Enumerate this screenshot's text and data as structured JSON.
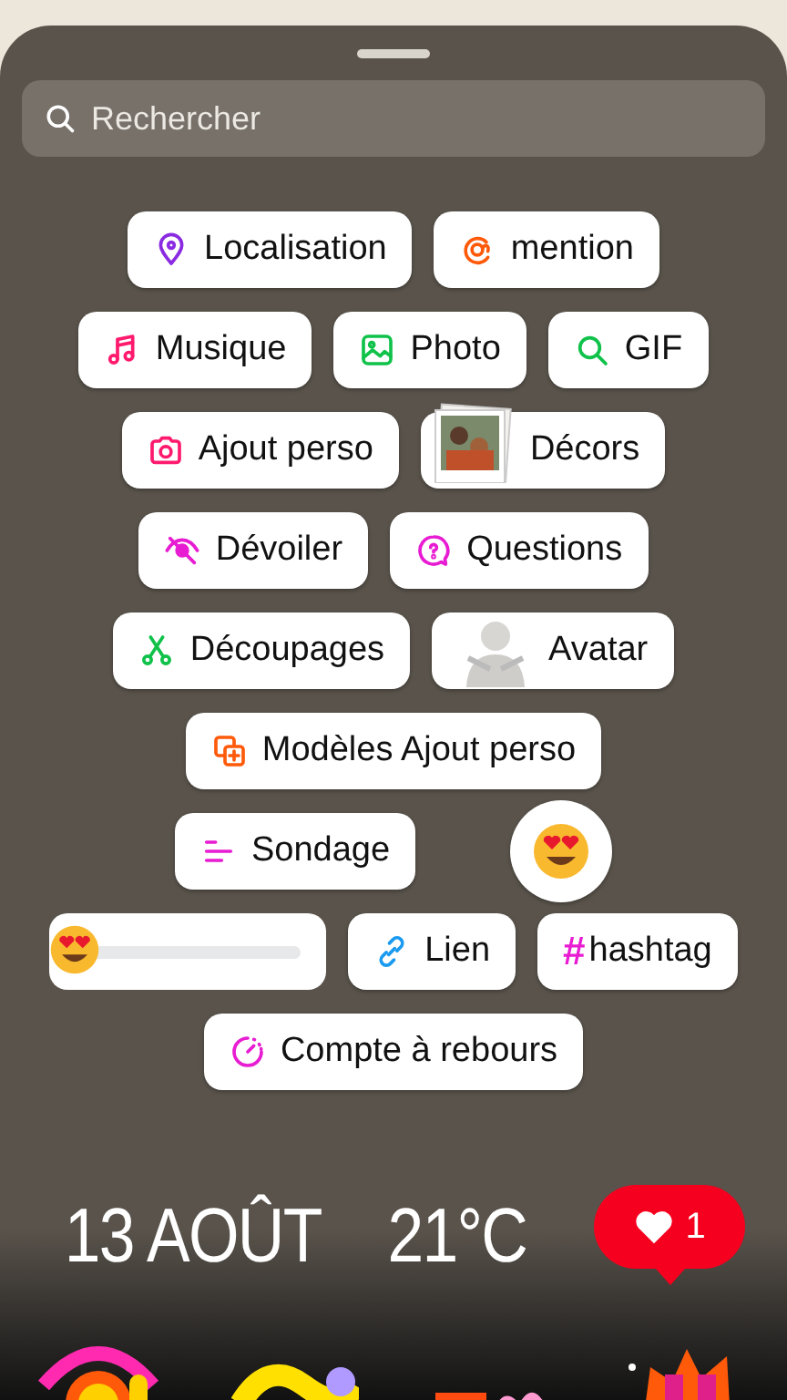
{
  "search": {
    "placeholder": "Rechercher"
  },
  "sticker_rows": [
    [
      {
        "kind": "location",
        "label": "Localisation"
      },
      {
        "kind": "mention",
        "label": "mention"
      }
    ],
    [
      {
        "kind": "music",
        "label": "Musique"
      },
      {
        "kind": "photo",
        "label": "Photo"
      },
      {
        "kind": "gif",
        "label": "GIF"
      }
    ],
    [
      {
        "kind": "addyours",
        "label": "Ajout perso"
      },
      {
        "kind": "frames",
        "label": "Décors"
      }
    ],
    [
      {
        "kind": "reveal",
        "label": "Dévoiler"
      },
      {
        "kind": "questions",
        "label": "Questions"
      }
    ],
    [
      {
        "kind": "cutouts",
        "label": "Découpages"
      },
      {
        "kind": "avatar",
        "label": "Avatar"
      }
    ],
    [
      {
        "kind": "templates",
        "label": "Modèles Ajout perso"
      }
    ],
    [
      {
        "kind": "poll",
        "label": "Sondage"
      },
      {
        "kind": "emoji"
      }
    ],
    [
      {
        "kind": "slider",
        "level": 0
      },
      {
        "kind": "link",
        "label": "Lien"
      },
      {
        "kind": "hashtag",
        "symbol": "#",
        "label": "hashtag"
      }
    ],
    [
      {
        "kind": "countdown",
        "label": "Compte à rebours"
      }
    ]
  ],
  "date": "13 AOÛT",
  "temperature": "21°C",
  "like": {
    "count": "1"
  }
}
